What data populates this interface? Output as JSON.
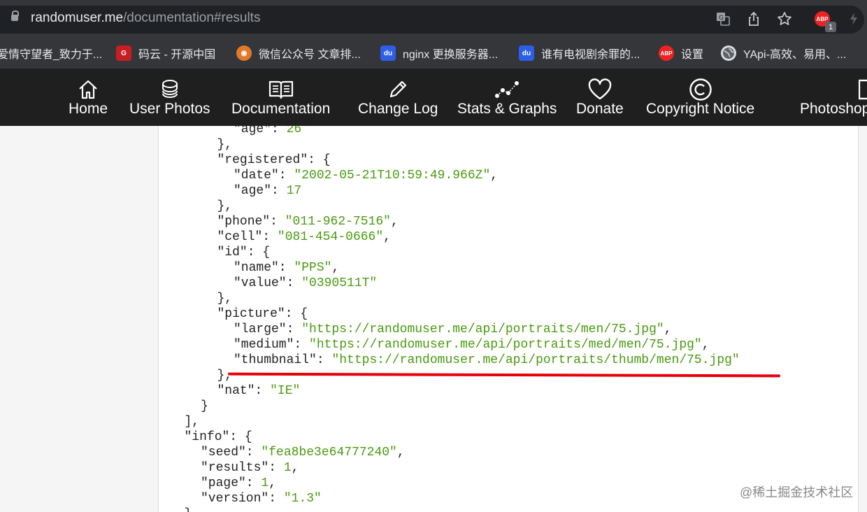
{
  "browser": {
    "url_host": "randomuser.me",
    "url_path": "/documentation#results",
    "abp_badge": "ABP",
    "abp_count": "1"
  },
  "bookmarks": [
    {
      "label": "爱情守望者_致力于...",
      "icon": "none"
    },
    {
      "label": "码云 - 开源中国",
      "icon": "gitee-icon",
      "mark": "G"
    },
    {
      "label": "微信公众号 文章排...",
      "icon": "owl-icon"
    },
    {
      "label": "nginx 更换服务器...",
      "icon": "baidu-paw-icon",
      "mark": "du"
    },
    {
      "label": "谁有电视剧余罪的...",
      "icon": "baidu-paw-icon",
      "mark": "du"
    },
    {
      "label": "设置",
      "icon": "abp-icon",
      "mark": "ABP"
    },
    {
      "label": "YApi-高效、易用、...",
      "icon": "globe-icon"
    }
  ],
  "site_nav": [
    {
      "label": "Home",
      "icon": "house-icon"
    },
    {
      "label": "User Photos",
      "icon": "coins-icon"
    },
    {
      "label": "Documentation",
      "icon": "book-icon"
    },
    {
      "label": "Change Log",
      "icon": "pencil-icon"
    },
    {
      "label": "Stats & Graphs",
      "icon": "graph-icon"
    },
    {
      "label": "Donate",
      "icon": "heart-icon"
    },
    {
      "label": "Copyright Notice",
      "icon": "copyright-icon"
    },
    {
      "label": "Photoshop",
      "icon": "photoshop-icon"
    }
  ],
  "code_lines": [
    {
      "indent": 4,
      "key": "age",
      "value": "26",
      "type": "num",
      "trail": ""
    },
    {
      "indent": 3,
      "text": "},"
    },
    {
      "indent": 3,
      "key": "registered",
      "open": "{"
    },
    {
      "indent": 4,
      "key": "date",
      "value": "2002-05-21T10:59:49.966Z",
      "type": "str",
      "trail": ","
    },
    {
      "indent": 4,
      "key": "age",
      "value": "17",
      "type": "num",
      "trail": ""
    },
    {
      "indent": 3,
      "text": "},"
    },
    {
      "indent": 3,
      "key": "phone",
      "value": "011-962-7516",
      "type": "str",
      "trail": ","
    },
    {
      "indent": 3,
      "key": "cell",
      "value": "081-454-0666",
      "type": "str",
      "trail": ","
    },
    {
      "indent": 3,
      "key": "id",
      "open": "{"
    },
    {
      "indent": 4,
      "key": "name",
      "value": "PPS",
      "type": "str",
      "trail": ","
    },
    {
      "indent": 4,
      "key": "value",
      "value": "0390511T",
      "type": "str",
      "trail": ""
    },
    {
      "indent": 3,
      "text": "},"
    },
    {
      "indent": 3,
      "key": "picture",
      "open": "{"
    },
    {
      "indent": 4,
      "key": "large",
      "value": "https://randomuser.me/api/portraits/men/75.jpg",
      "type": "str",
      "trail": ","
    },
    {
      "indent": 4,
      "key": "medium",
      "value": "https://randomuser.me/api/portraits/med/men/75.jpg",
      "type": "str",
      "trail": ","
    },
    {
      "indent": 4,
      "key": "thumbnail",
      "value": "https://randomuser.me/api/portraits/thumb/men/75.jpg",
      "type": "str",
      "trail": ""
    },
    {
      "indent": 3,
      "text": "},"
    },
    {
      "indent": 3,
      "key": "nat",
      "value": "IE",
      "type": "str",
      "trail": ""
    },
    {
      "indent": 2,
      "text": "}"
    },
    {
      "indent": 1,
      "text": "],"
    },
    {
      "indent": 1,
      "key": "info",
      "open": "{"
    },
    {
      "indent": 2,
      "key": "seed",
      "value": "fea8be3e64777240",
      "type": "str",
      "trail": ","
    },
    {
      "indent": 2,
      "key": "results",
      "value": "1",
      "type": "num",
      "trail": ","
    },
    {
      "indent": 2,
      "key": "page",
      "value": "1",
      "type": "num",
      "trail": ","
    },
    {
      "indent": 2,
      "key": "version",
      "value": "1.3",
      "type": "str",
      "trail": ""
    },
    {
      "indent": 1,
      "text": "}"
    }
  ],
  "watermark": "@稀土掘金技术社区",
  "colors": {
    "string_value": "#4a9a10",
    "highlight_underline": "#e8000b",
    "nav_bg": "#1f1f1f"
  }
}
